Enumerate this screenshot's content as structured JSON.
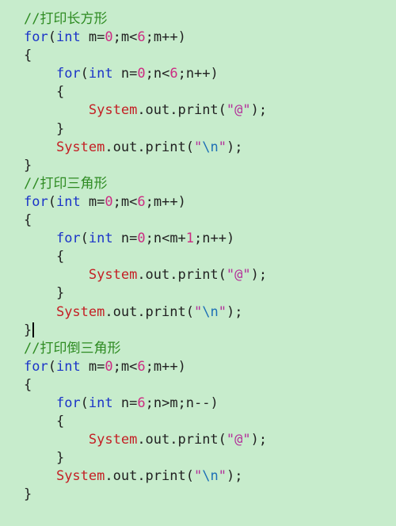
{
  "colors": {
    "background": "#c7eccc",
    "comment": "#2e8b22",
    "keyword": "#1b34c8",
    "number": "#cc2b82",
    "class_name": "#c41f24",
    "string": "#b4309a",
    "escape": "#1e70b6",
    "default": "#222222"
  },
  "lines": [
    [
      {
        "t": "cm",
        "v": "//打印长方形"
      }
    ],
    [
      {
        "t": "kw",
        "v": "for"
      },
      {
        "t": "op",
        "v": "("
      },
      {
        "t": "kw",
        "v": "int"
      },
      {
        "t": "op",
        "v": " m="
      },
      {
        "t": "num",
        "v": "0"
      },
      {
        "t": "op",
        "v": ";m<"
      },
      {
        "t": "num",
        "v": "6"
      },
      {
        "t": "op",
        "v": ";m++)"
      }
    ],
    [
      {
        "t": "op",
        "v": "{"
      }
    ],
    [
      {
        "t": "op",
        "v": "    "
      },
      {
        "t": "kw",
        "v": "for"
      },
      {
        "t": "op",
        "v": "("
      },
      {
        "t": "kw",
        "v": "int"
      },
      {
        "t": "op",
        "v": " n="
      },
      {
        "t": "num",
        "v": "0"
      },
      {
        "t": "op",
        "v": ";n<"
      },
      {
        "t": "num",
        "v": "6"
      },
      {
        "t": "op",
        "v": ";n++)"
      }
    ],
    [
      {
        "t": "op",
        "v": "    {"
      }
    ],
    [
      {
        "t": "op",
        "v": "        "
      },
      {
        "t": "cls",
        "v": "System"
      },
      {
        "t": "op",
        "v": ".out.print("
      },
      {
        "t": "str",
        "v": "\"@\""
      },
      {
        "t": "op",
        "v": ");"
      }
    ],
    [
      {
        "t": "op",
        "v": "    }"
      }
    ],
    [
      {
        "t": "op",
        "v": "    "
      },
      {
        "t": "cls",
        "v": "System"
      },
      {
        "t": "op",
        "v": ".out.print("
      },
      {
        "t": "str",
        "v": "\""
      },
      {
        "t": "esc",
        "v": "\\n"
      },
      {
        "t": "str",
        "v": "\""
      },
      {
        "t": "op",
        "v": ");"
      }
    ],
    [
      {
        "t": "op",
        "v": "}"
      }
    ],
    [
      {
        "t": "cm",
        "v": "//打印三角形"
      }
    ],
    [
      {
        "t": "kw",
        "v": "for"
      },
      {
        "t": "op",
        "v": "("
      },
      {
        "t": "kw",
        "v": "int"
      },
      {
        "t": "op",
        "v": " m="
      },
      {
        "t": "num",
        "v": "0"
      },
      {
        "t": "op",
        "v": ";m<"
      },
      {
        "t": "num",
        "v": "6"
      },
      {
        "t": "op",
        "v": ";m++)"
      }
    ],
    [
      {
        "t": "op",
        "v": "{"
      }
    ],
    [
      {
        "t": "op",
        "v": "    "
      },
      {
        "t": "kw",
        "v": "for"
      },
      {
        "t": "op",
        "v": "("
      },
      {
        "t": "kw",
        "v": "int"
      },
      {
        "t": "op",
        "v": " n="
      },
      {
        "t": "num",
        "v": "0"
      },
      {
        "t": "op",
        "v": ";n<m+"
      },
      {
        "t": "num",
        "v": "1"
      },
      {
        "t": "op",
        "v": ";n++)"
      }
    ],
    [
      {
        "t": "op",
        "v": "    {"
      }
    ],
    [
      {
        "t": "op",
        "v": "        "
      },
      {
        "t": "cls",
        "v": "System"
      },
      {
        "t": "op",
        "v": ".out.print("
      },
      {
        "t": "str",
        "v": "\"@\""
      },
      {
        "t": "op",
        "v": ");"
      }
    ],
    [
      {
        "t": "op",
        "v": "    }"
      }
    ],
    [
      {
        "t": "op",
        "v": "    "
      },
      {
        "t": "cls",
        "v": "System"
      },
      {
        "t": "op",
        "v": ".out.print("
      },
      {
        "t": "str",
        "v": "\""
      },
      {
        "t": "esc",
        "v": "\\n"
      },
      {
        "t": "str",
        "v": "\""
      },
      {
        "t": "op",
        "v": ");"
      }
    ],
    [
      {
        "t": "op",
        "v": "}"
      },
      {
        "t": "caret",
        "v": ""
      }
    ],
    [
      {
        "t": "cm",
        "v": "//打印倒三角形"
      }
    ],
    [
      {
        "t": "kw",
        "v": "for"
      },
      {
        "t": "op",
        "v": "("
      },
      {
        "t": "kw",
        "v": "int"
      },
      {
        "t": "op",
        "v": " m="
      },
      {
        "t": "num",
        "v": "0"
      },
      {
        "t": "op",
        "v": ";m<"
      },
      {
        "t": "num",
        "v": "6"
      },
      {
        "t": "op",
        "v": ";m++)"
      }
    ],
    [
      {
        "t": "op",
        "v": "{"
      }
    ],
    [
      {
        "t": "op",
        "v": "    "
      },
      {
        "t": "kw",
        "v": "for"
      },
      {
        "t": "op",
        "v": "("
      },
      {
        "t": "kw",
        "v": "int"
      },
      {
        "t": "op",
        "v": " n="
      },
      {
        "t": "num",
        "v": "6"
      },
      {
        "t": "op",
        "v": ";n>m;n--)"
      }
    ],
    [
      {
        "t": "op",
        "v": "    {"
      }
    ],
    [
      {
        "t": "op",
        "v": "        "
      },
      {
        "t": "cls",
        "v": "System"
      },
      {
        "t": "op",
        "v": ".out.print("
      },
      {
        "t": "str",
        "v": "\"@\""
      },
      {
        "t": "op",
        "v": ");"
      }
    ],
    [
      {
        "t": "op",
        "v": "    }"
      }
    ],
    [
      {
        "t": "op",
        "v": "    "
      },
      {
        "t": "cls",
        "v": "System"
      },
      {
        "t": "op",
        "v": ".out.print("
      },
      {
        "t": "str",
        "v": "\""
      },
      {
        "t": "esc",
        "v": "\\n"
      },
      {
        "t": "str",
        "v": "\""
      },
      {
        "t": "op",
        "v": ");"
      }
    ],
    [
      {
        "t": "op",
        "v": "}"
      }
    ]
  ]
}
